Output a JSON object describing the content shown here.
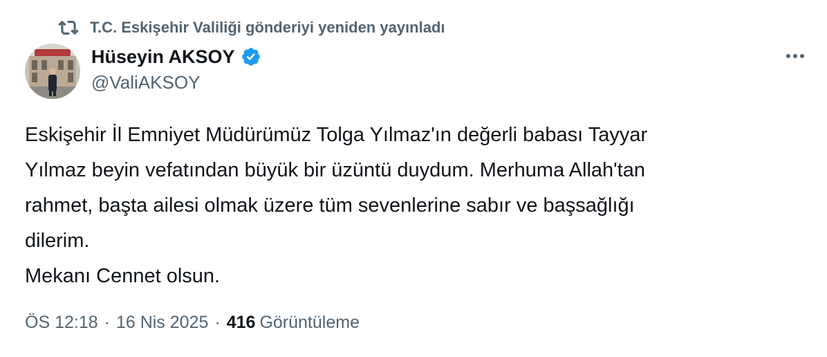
{
  "repost": {
    "text": "T.C. Eskişehir Valiliği gönderiyi yeniden yayınladı"
  },
  "author": {
    "display_name": "Hüseyin AKSOY",
    "handle": "@ValiAKSOY",
    "verified": true
  },
  "tweet": {
    "text_lines": [
      "Eskişehir İl Emniyet Müdürümüz Tolga Yılmaz'ın değerli babası Tayyar",
      "Yılmaz beyin vefatından büyük bir üzüntü duydum. Merhuma Allah'tan",
      "rahmet, başta ailesi olmak üzere tüm sevenlerine sabır ve başsağlığı",
      "dilerim.",
      "Mekanı Cennet olsun."
    ]
  },
  "meta": {
    "time": "ÖS 12:18",
    "separator": "·",
    "date": "16 Nis 2025",
    "views_count": "416",
    "views_label": "Görüntüleme"
  },
  "icons": {
    "repost": "repost-icon",
    "verified": "verified-badge-icon",
    "more": "more-options-icon"
  },
  "colors": {
    "text_primary": "#0f1419",
    "text_secondary": "#536471",
    "verified_blue": "#1d9bf0"
  }
}
